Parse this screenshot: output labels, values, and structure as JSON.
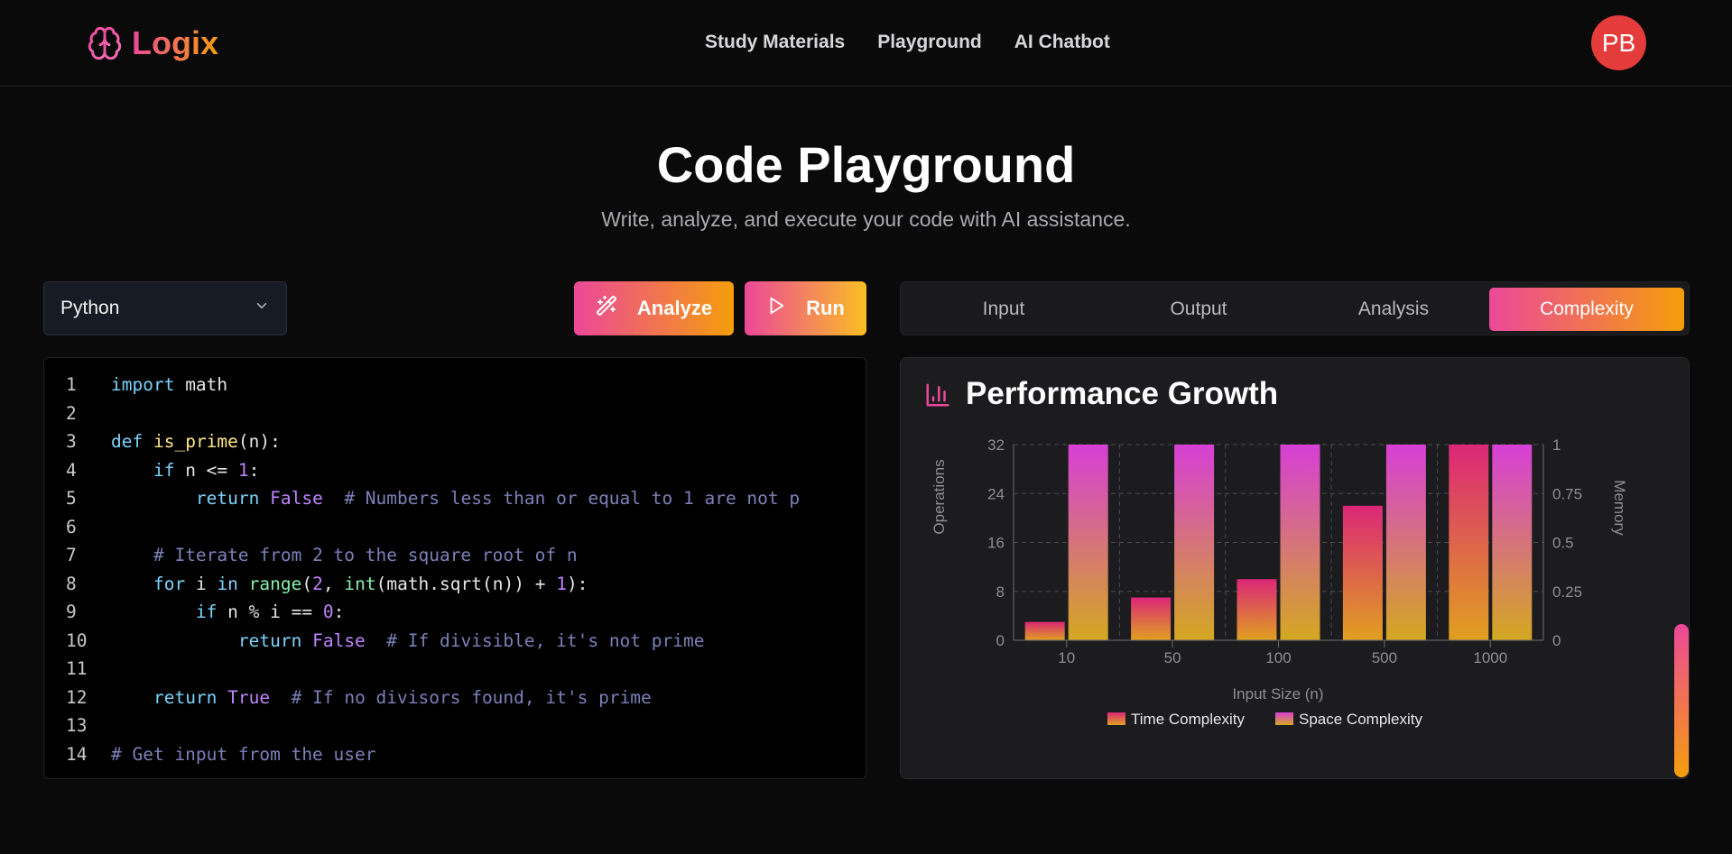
{
  "header": {
    "logo_text": "Logix",
    "nav": [
      "Study Materials",
      "Playground",
      "AI Chatbot"
    ],
    "avatar_initials": "PB"
  },
  "hero": {
    "title": "Code Playground",
    "subtitle": "Write, analyze, and execute your code with AI assistance."
  },
  "toolbar": {
    "language": "Python",
    "analyze_label": "Analyze",
    "run_label": "Run"
  },
  "editor": {
    "line_numbers": [
      "1",
      "2",
      "3",
      "4",
      "5",
      "6",
      "7",
      "8",
      "9",
      "10",
      "11",
      "12",
      "13",
      "14"
    ]
  },
  "tabs": {
    "items": [
      "Input",
      "Output",
      "Analysis",
      "Complexity"
    ],
    "active": "Complexity"
  },
  "complexity_panel": {
    "title": "Performance Growth"
  },
  "colors": {
    "accent_start": "#ec4899",
    "accent_end": "#f59e0b",
    "space_bar_top": "#d946ef",
    "time_bar_top": "#db2777"
  },
  "chart_data": {
    "type": "bar",
    "title": "Performance Growth",
    "xlabel": "Input Size (n)",
    "ylabel": "Operations",
    "y2label": "Memory",
    "categories": [
      "10",
      "50",
      "100",
      "500",
      "1000"
    ],
    "ylim": [
      0,
      32
    ],
    "yticks": [
      "0",
      "8",
      "16",
      "24",
      "32"
    ],
    "y2lim": [
      0,
      1
    ],
    "y2ticks": [
      "0",
      "0.25",
      "0.5",
      "0.75",
      "1"
    ],
    "series": [
      {
        "name": "Time Complexity",
        "axis": "left",
        "values": [
          3,
          7,
          10,
          22,
          32
        ]
      },
      {
        "name": "Space Complexity",
        "axis": "right",
        "values": [
          1,
          1,
          1,
          1,
          1
        ]
      }
    ],
    "legend": "bottom",
    "grid": true
  }
}
